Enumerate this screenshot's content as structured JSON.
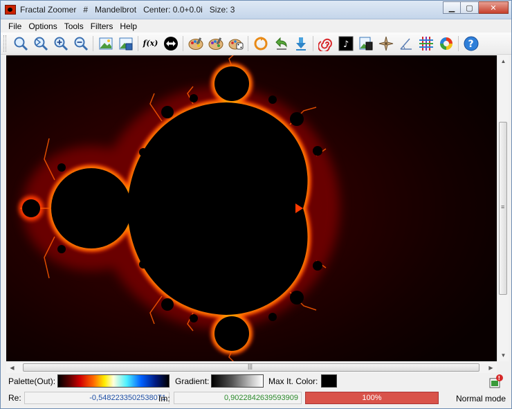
{
  "window": {
    "title": "Fractal Zoomer   #   Mandelbrot   Center: 0.0+0.0i   Size: 3",
    "controls": {
      "minimize": "▁",
      "maximize": "▢",
      "close": "✕"
    }
  },
  "menu": [
    "File",
    "Options",
    "Tools",
    "Filters",
    "Help"
  ],
  "toolbar": [
    "zoom-in-magnifier-icon",
    "zoom-out-magnifier-icon",
    "zoom-plus-icon",
    "zoom-minus-icon",
    "save-image-icon",
    "save-settings-icon",
    "function-icon",
    "swap-icon",
    "palette-out-icon",
    "palette-in-icon",
    "random-palette-icon",
    "rotate-icon",
    "undo-icon",
    "download-icon",
    "spiral-icon",
    "music-icon",
    "overview-icon",
    "compass-icon",
    "angle-icon",
    "grid-icon",
    "color-cycle-icon",
    "help-icon"
  ],
  "function_glyph": "f(x)",
  "help_glyph": "?",
  "music_glyph": "♪",
  "palette": {
    "out_label": "Palette(Out):",
    "gradient_label": "Gradient:",
    "maxit_label": "Max It. Color:",
    "maxit_color": "#000000"
  },
  "status": {
    "re_label": "Re:",
    "re_value": "-0,5482233502538071",
    "im_label": "Im:",
    "im_value": "0,9022842639593909",
    "progress_text": "100%",
    "progress_value": 1.0,
    "mode": "Normal mode"
  },
  "fractal": {
    "type": "Mandelbrot",
    "center": "0.0+0.0i",
    "size": "3"
  },
  "colors": {
    "outside_dark": "#0d0000",
    "edge_glow": "#ff3a00",
    "set_interior": "#000000",
    "progress": "#d9534a"
  }
}
